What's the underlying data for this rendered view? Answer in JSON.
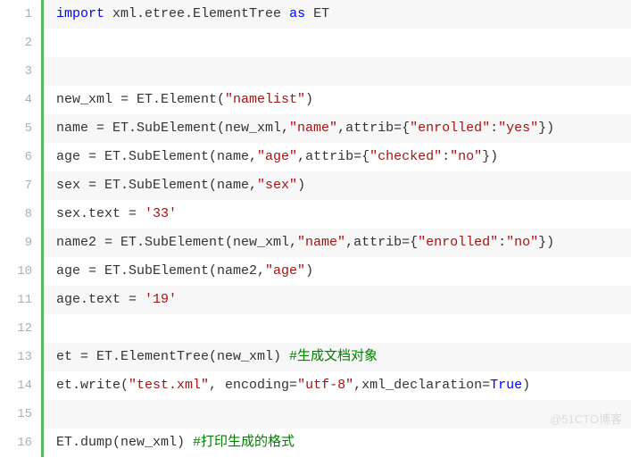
{
  "watermark": "@51CTO博客",
  "lines": [
    {
      "n": "1",
      "tokens": [
        {
          "c": "kw",
          "t": "import"
        },
        {
          "c": "pl",
          "t": " xml.etree.ElementTree "
        },
        {
          "c": "kw",
          "t": "as"
        },
        {
          "c": "pl",
          "t": " ET"
        }
      ]
    },
    {
      "n": "2",
      "tokens": []
    },
    {
      "n": "3",
      "tokens": []
    },
    {
      "n": "4",
      "tokens": [
        {
          "c": "pl",
          "t": "new_xml = ET.Element("
        },
        {
          "c": "str",
          "t": "\"namelist\""
        },
        {
          "c": "pl",
          "t": ")"
        }
      ]
    },
    {
      "n": "5",
      "tokens": [
        {
          "c": "pl",
          "t": "name = ET.SubElement(new_xml,"
        },
        {
          "c": "str",
          "t": "\"name\""
        },
        {
          "c": "pl",
          "t": ",attrib={"
        },
        {
          "c": "str",
          "t": "\"enrolled\""
        },
        {
          "c": "pl",
          "t": ":"
        },
        {
          "c": "str",
          "t": "\"yes\""
        },
        {
          "c": "pl",
          "t": "})"
        }
      ]
    },
    {
      "n": "6",
      "tokens": [
        {
          "c": "pl",
          "t": "age = ET.SubElement(name,"
        },
        {
          "c": "str",
          "t": "\"age\""
        },
        {
          "c": "pl",
          "t": ",attrib={"
        },
        {
          "c": "str",
          "t": "\"checked\""
        },
        {
          "c": "pl",
          "t": ":"
        },
        {
          "c": "str",
          "t": "\"no\""
        },
        {
          "c": "pl",
          "t": "})"
        }
      ]
    },
    {
      "n": "7",
      "tokens": [
        {
          "c": "pl",
          "t": "sex = ET.SubElement(name,"
        },
        {
          "c": "str",
          "t": "\"sex\""
        },
        {
          "c": "pl",
          "t": ")"
        }
      ]
    },
    {
      "n": "8",
      "tokens": [
        {
          "c": "pl",
          "t": "sex.text = "
        },
        {
          "c": "str",
          "t": "'33'"
        }
      ]
    },
    {
      "n": "9",
      "tokens": [
        {
          "c": "pl",
          "t": "name2 = ET.SubElement(new_xml,"
        },
        {
          "c": "str",
          "t": "\"name\""
        },
        {
          "c": "pl",
          "t": ",attrib={"
        },
        {
          "c": "str",
          "t": "\"enrolled\""
        },
        {
          "c": "pl",
          "t": ":"
        },
        {
          "c": "str",
          "t": "\"no\""
        },
        {
          "c": "pl",
          "t": "})"
        }
      ]
    },
    {
      "n": "10",
      "tokens": [
        {
          "c": "pl",
          "t": "age = ET.SubElement(name2,"
        },
        {
          "c": "str",
          "t": "\"age\""
        },
        {
          "c": "pl",
          "t": ")"
        }
      ]
    },
    {
      "n": "11",
      "tokens": [
        {
          "c": "pl",
          "t": "age.text = "
        },
        {
          "c": "str",
          "t": "'19'"
        }
      ]
    },
    {
      "n": "12",
      "tokens": []
    },
    {
      "n": "13",
      "tokens": [
        {
          "c": "pl",
          "t": "et = ET.ElementTree(new_xml) "
        },
        {
          "c": "cm",
          "t": "#生成文档对象"
        }
      ]
    },
    {
      "n": "14",
      "tokens": [
        {
          "c": "pl",
          "t": "et.write("
        },
        {
          "c": "str",
          "t": "\"test.xml\""
        },
        {
          "c": "pl",
          "t": ", encoding="
        },
        {
          "c": "str",
          "t": "\"utf-8\""
        },
        {
          "c": "pl",
          "t": ",xml_declaration="
        },
        {
          "c": "lit",
          "t": "True"
        },
        {
          "c": "pl",
          "t": ")"
        }
      ]
    },
    {
      "n": "15",
      "tokens": []
    },
    {
      "n": "16",
      "tokens": [
        {
          "c": "pl",
          "t": "ET.dump(new_xml) "
        },
        {
          "c": "cm",
          "t": "#打印生成的格式"
        }
      ]
    }
  ]
}
